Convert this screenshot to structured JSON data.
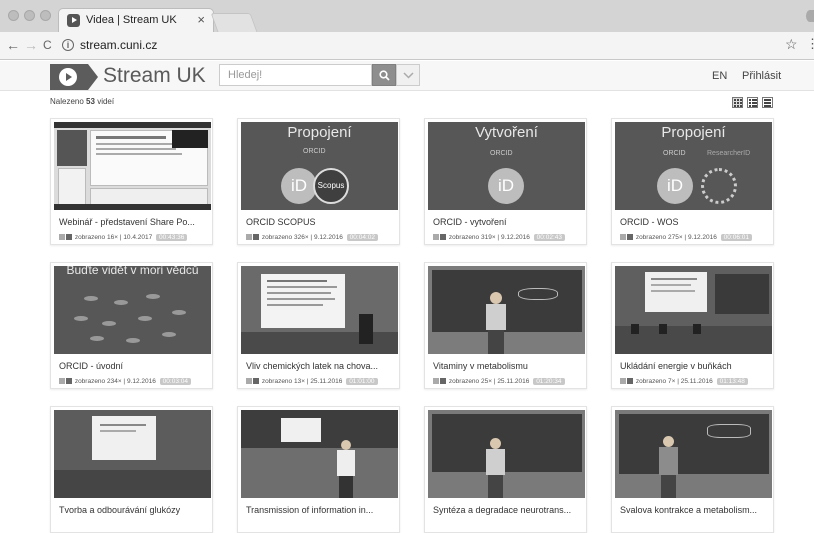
{
  "browser": {
    "tab_title": "Videa | Stream UK",
    "tab_close": "×",
    "url": "stream.cuni.cz",
    "back": "←",
    "forward": "→",
    "reload": "C",
    "star": "☆",
    "menu": "⋮"
  },
  "header": {
    "site_name": "Stream UK",
    "search_placeholder": "Hledej!",
    "lang": "EN",
    "login": "Přihlásit"
  },
  "results": {
    "prefix": "Nalezeno",
    "count": "53",
    "suffix": "videí"
  },
  "videos": [
    {
      "title": "Webinář - představení Share Po...",
      "views": "zobrazeno 16×",
      "date": "10.4.2017",
      "duration": "00:43:36"
    },
    {
      "title": "ORCID SCOPUS",
      "views": "zobrazeno 326×",
      "date": "9.12.2016",
      "duration": "00:04:02"
    },
    {
      "title": "ORCID - vytvoření",
      "views": "zobrazeno 319×",
      "date": "9.12.2016",
      "duration": "00:02:43"
    },
    {
      "title": "ORCID - WOS",
      "views": "zobrazeno 275×",
      "date": "9.12.2016",
      "duration": "00:06:01"
    },
    {
      "title": "ORCID - úvodní",
      "views": "zobrazeno 234×",
      "date": "9.12.2016",
      "duration": "00:03:04"
    },
    {
      "title": "Vliv chemických latek na chova...",
      "views": "zobrazeno 13×",
      "date": "25.11.2016",
      "duration": "01:01:00"
    },
    {
      "title": "Vitaminy v metabolismu",
      "views": "zobrazeno 25×",
      "date": "25.11.2016",
      "duration": "01:20:34"
    },
    {
      "title": "Ukládání energie v buňkách",
      "views": "zobrazeno 7×",
      "date": "25.11.2016",
      "duration": "01:13:48"
    },
    {
      "title": "Tvorba a odbourávání glukózy",
      "views": "",
      "date": "",
      "duration": ""
    },
    {
      "title": "Transmission of information in...",
      "views": "",
      "date": "",
      "duration": ""
    },
    {
      "title": "Syntéza a degradace neurotrans...",
      "views": "",
      "date": "",
      "duration": ""
    },
    {
      "title": "Svalova kontrakce a metabolism...",
      "views": "",
      "date": "",
      "duration": ""
    }
  ],
  "slides": {
    "propojeni": "Propojení",
    "vytvoreni": "Vytvoření",
    "orcid": "ORCID",
    "id": "iD",
    "scopus": "Scopus",
    "researcherid": "ResearcherID",
    "budte": "Buďte vidět v mori vědců"
  }
}
